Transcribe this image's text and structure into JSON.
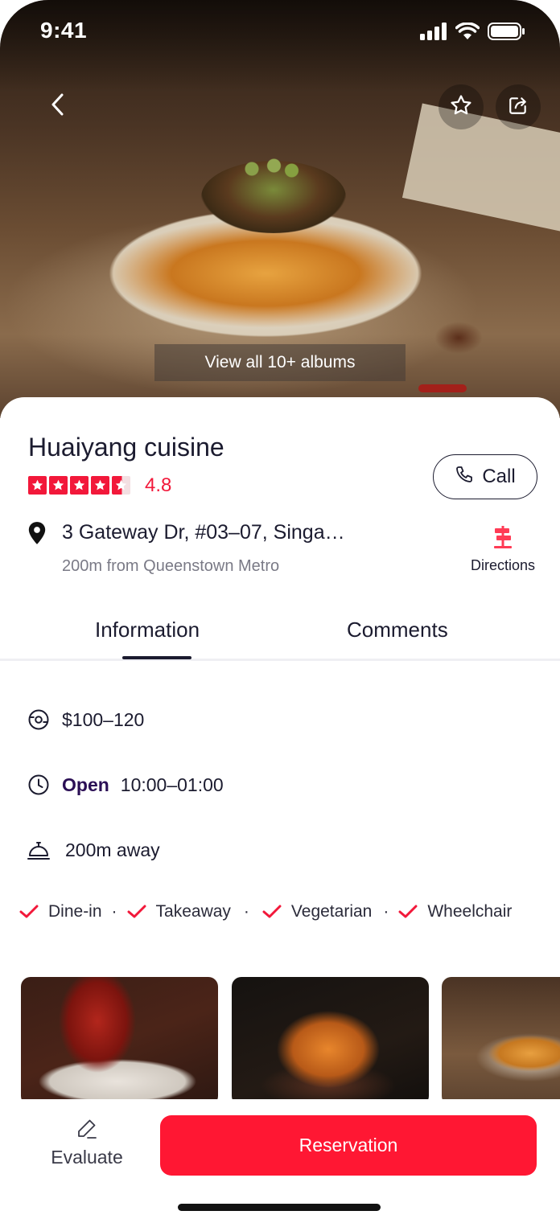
{
  "status_bar": {
    "time": "9:41"
  },
  "hero": {
    "albums_label": "View all 10+ albums"
  },
  "restaurant": {
    "name": "Huaiyang cuisine",
    "rating": "4.8",
    "rating_value": 4.5,
    "call_label": "Call",
    "address": "3 Gateway Dr, #03–07, Singa…",
    "metro_distance": "200m from Queenstown Metro",
    "directions_label": "Directions"
  },
  "tabs": [
    {
      "label": "Information",
      "active": true
    },
    {
      "label": "Comments",
      "active": false
    }
  ],
  "info": {
    "price": "$100–120",
    "open_label": "Open",
    "hours": "10:00–01:00",
    "distance": "200m away"
  },
  "tags": [
    "Dine-in",
    "Takeaway",
    "Vegetarian",
    "Wheelchair"
  ],
  "photos": [
    "lobster-photo",
    "crab-photo",
    "noodles-photo"
  ],
  "bottom_bar": {
    "evaluate_label": "Evaluate",
    "reservation_label": "Reservation"
  },
  "colors": {
    "accent": "#ff1733",
    "star": "#f2183a",
    "text_dark": "#1b1b2f",
    "open": "#2b0f55"
  },
  "icons": [
    "back-icon",
    "star-outline-icon",
    "share-icon",
    "phone-icon",
    "location-pin-icon",
    "signpost-icon",
    "price-icon",
    "clock-icon",
    "bell-icon",
    "check-icon",
    "pencil-icon",
    "signal-icon",
    "wifi-icon",
    "battery-icon"
  ]
}
